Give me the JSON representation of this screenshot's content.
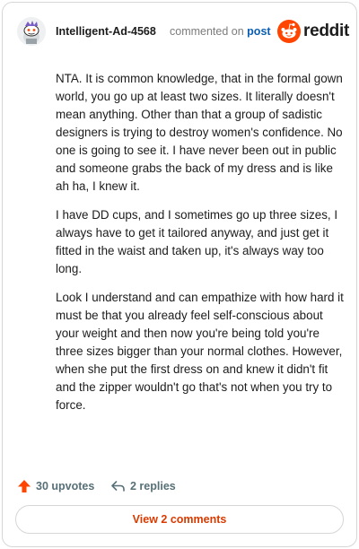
{
  "header": {
    "author": "Intelligent-Ad-4568",
    "action": "commented on",
    "post_link": "post",
    "brand": "reddit"
  },
  "comment": {
    "paragraphs": [
      "NTA. It is common knowledge, that in the formal gown world, you go up at least two sizes. It literally doesn't mean anything. Other than that a group of sadistic designers is trying to destroy women's confidence. No one is going to see it. I have never been out in public and someone grabs the back of my dress and is like ah ha, I knew it.",
      "I have DD cups, and I sometimes go up three sizes, I always have to get it tailored anyway, and just get it fitted in the waist and taken up, it's always way too long.",
      "Look I understand and can empathize with how hard it must be that you already feel self-conscious about your weight and then now you're being told you're three sizes bigger than your normal clothes. However, when she put the first dress on and knew it didn't fit and the zipper wouldn't go that's not when you try to force."
    ]
  },
  "actions": {
    "upvotes": "30 upvotes",
    "replies": "2 replies"
  },
  "footer": {
    "view_comments": "View 2 comments"
  },
  "colors": {
    "brand": "#ff4500",
    "upvote": "#ff4500",
    "link": "#0b5eb3",
    "view_comments": "#d93a00"
  },
  "icons": {
    "avatar": "snoo-avatar-icon",
    "logo": "reddit-logo-icon",
    "upvote": "upvote-arrow-icon",
    "reply": "reply-arrow-icon"
  }
}
